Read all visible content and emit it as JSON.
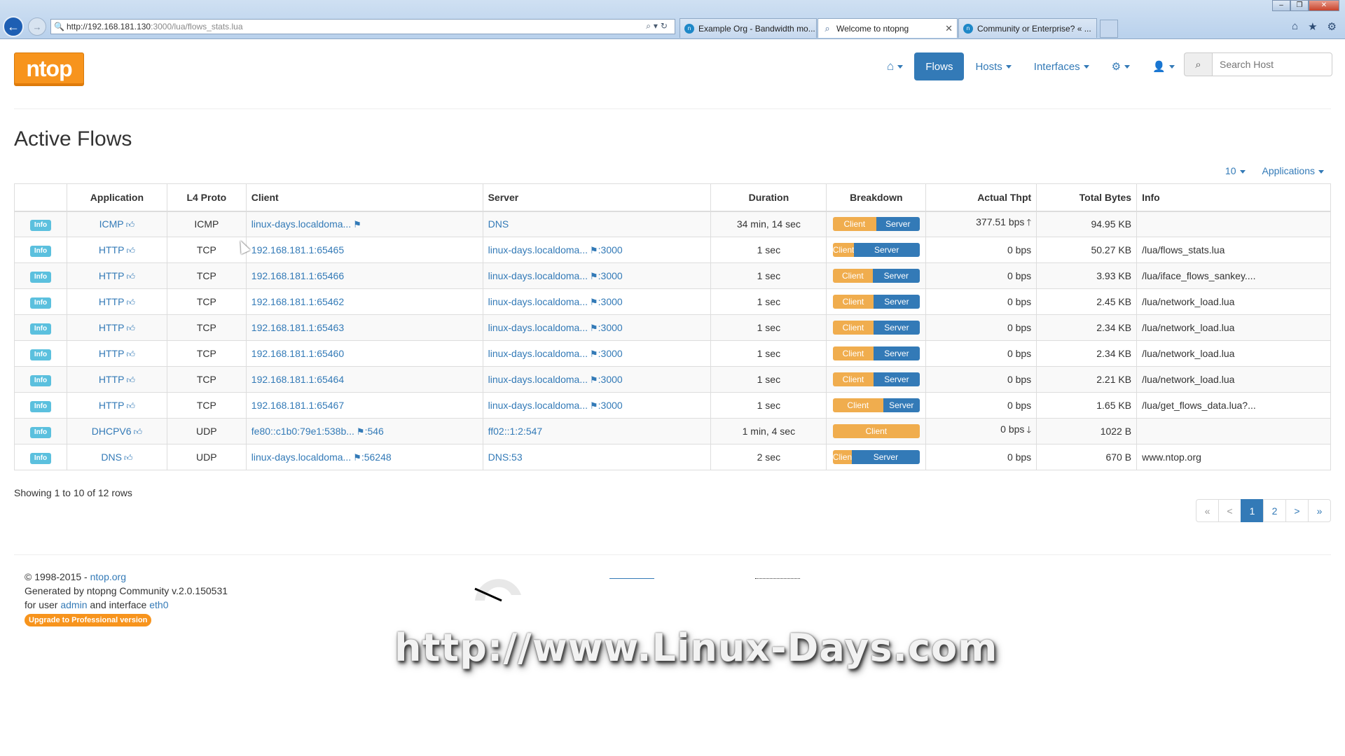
{
  "browser": {
    "url_host": "http://192.168.181.130",
    "url_rest": ":3000/lua/flows_stats.lua",
    "tabs": [
      {
        "title": "Example Org - Bandwidth mo...",
        "active": false
      },
      {
        "title": "Welcome to ntopng",
        "active": true
      },
      {
        "title": "Community or Enterprise? « ...",
        "active": false
      }
    ]
  },
  "navbar": {
    "logo": "ntop",
    "flows": "Flows",
    "hosts": "Hosts",
    "interfaces": "Interfaces",
    "search_placeholder": "Search Host"
  },
  "page": {
    "title": "Active Flows",
    "toolbar": {
      "rows_per_page": "10",
      "applications": "Applications"
    }
  },
  "table": {
    "headers": [
      "Application",
      "L4 Proto",
      "Client",
      "Server",
      "Duration",
      "Breakdown",
      "Actual Thpt",
      "Total Bytes",
      "Info"
    ],
    "rows": [
      {
        "info": "Info",
        "app": "ICMP",
        "proto": "ICMP",
        "client": "linux-days.localdoma...",
        "client_flag": true,
        "client_port": "",
        "server": "DNS",
        "server_flag": false,
        "server_port": "",
        "duration": "34 min, 14 sec",
        "client_pct": 50,
        "client_label": "Client",
        "server_label": "Server",
        "thpt": "377.51 bps",
        "trend": "up",
        "bytes": "94.95 KB",
        "info_text": ""
      },
      {
        "info": "Info",
        "app": "HTTP",
        "proto": "TCP",
        "client": "192.168.181.1:65465",
        "client_flag": false,
        "client_port": "",
        "server": "linux-days.localdoma...",
        "server_flag": true,
        "server_port": ":3000",
        "duration": "1 sec",
        "client_pct": 24,
        "client_label": "Client",
        "server_label": "Server",
        "thpt": "0 bps",
        "trend": "",
        "bytes": "50.27 KB",
        "info_text": "/lua/flows_stats.lua"
      },
      {
        "info": "Info",
        "app": "HTTP",
        "proto": "TCP",
        "client": "192.168.181.1:65466",
        "client_flag": false,
        "client_port": "",
        "server": "linux-days.localdoma...",
        "server_flag": true,
        "server_port": ":3000",
        "duration": "1 sec",
        "client_pct": 46,
        "client_label": "Client",
        "server_label": "Server",
        "thpt": "0 bps",
        "trend": "",
        "bytes": "3.93 KB",
        "info_text": "/lua/iface_flows_sankey...."
      },
      {
        "info": "Info",
        "app": "HTTP",
        "proto": "TCP",
        "client": "192.168.181.1:65462",
        "client_flag": false,
        "client_port": "",
        "server": "linux-days.localdoma...",
        "server_flag": true,
        "server_port": ":3000",
        "duration": "1 sec",
        "client_pct": 47,
        "client_label": "Client",
        "server_label": "Server",
        "thpt": "0 bps",
        "trend": "",
        "bytes": "2.45 KB",
        "info_text": "/lua/network_load.lua"
      },
      {
        "info": "Info",
        "app": "HTTP",
        "proto": "TCP",
        "client": "192.168.181.1:65463",
        "client_flag": false,
        "client_port": "",
        "server": "linux-days.localdoma...",
        "server_flag": true,
        "server_port": ":3000",
        "duration": "1 sec",
        "client_pct": 47,
        "client_label": "Client",
        "server_label": "Server",
        "thpt": "0 bps",
        "trend": "",
        "bytes": "2.34 KB",
        "info_text": "/lua/network_load.lua"
      },
      {
        "info": "Info",
        "app": "HTTP",
        "proto": "TCP",
        "client": "192.168.181.1:65460",
        "client_flag": false,
        "client_port": "",
        "server": "linux-days.localdoma...",
        "server_flag": true,
        "server_port": ":3000",
        "duration": "1 sec",
        "client_pct": 47,
        "client_label": "Client",
        "server_label": "Server",
        "thpt": "0 bps",
        "trend": "",
        "bytes": "2.34 KB",
        "info_text": "/lua/network_load.lua"
      },
      {
        "info": "Info",
        "app": "HTTP",
        "proto": "TCP",
        "client": "192.168.181.1:65464",
        "client_flag": false,
        "client_port": "",
        "server": "linux-days.localdoma...",
        "server_flag": true,
        "server_port": ":3000",
        "duration": "1 sec",
        "client_pct": 47,
        "client_label": "Client",
        "server_label": "Server",
        "thpt": "0 bps",
        "trend": "",
        "bytes": "2.21 KB",
        "info_text": "/lua/network_load.lua"
      },
      {
        "info": "Info",
        "app": "HTTP",
        "proto": "TCP",
        "client": "192.168.181.1:65467",
        "client_flag": false,
        "client_port": "",
        "server": "linux-days.localdoma...",
        "server_flag": true,
        "server_port": ":3000",
        "duration": "1 sec",
        "client_pct": 58,
        "client_label": "Client",
        "server_label": "Server",
        "thpt": "0 bps",
        "trend": "",
        "bytes": "1.65 KB",
        "info_text": "/lua/get_flows_data.lua?..."
      },
      {
        "info": "Info",
        "app": "DHCPV6",
        "proto": "UDP",
        "client": "fe80::c1b0:79e1:538b...",
        "client_flag": true,
        "client_port": ":546",
        "server": "ff02::1:2:547",
        "server_flag": false,
        "server_port": "",
        "duration": "1 min, 4 sec",
        "client_pct": 100,
        "client_label": "Client",
        "server_label": "",
        "thpt": "0 bps",
        "trend": "down",
        "bytes": "1022 B",
        "info_text": ""
      },
      {
        "info": "Info",
        "app": "DNS",
        "proto": "UDP",
        "client": "linux-days.localdoma...",
        "client_flag": true,
        "client_port": ":56248",
        "server": "DNS:53",
        "server_flag": false,
        "server_port": "",
        "duration": "2 sec",
        "client_pct": 22,
        "client_label": "Clien",
        "server_label": "Server",
        "thpt": "0 bps",
        "trend": "",
        "bytes": "670 B",
        "info_text": "www.ntop.org"
      }
    ]
  },
  "showing": "Showing 1 to 10 of 12 rows",
  "pagination": [
    "«",
    "<",
    "1",
    "2",
    ">",
    "»"
  ],
  "footer": {
    "copyright": "© 1998-2015 - ",
    "site": "ntop.org",
    "generated": "Generated by ntopng Community v.2.0.150531",
    "user_prefix": "for user ",
    "user": "admin",
    "iface_prefix": " and interface ",
    "iface": "eth0",
    "upgrade": "Upgrade to Professional version"
  },
  "watermark": "http://www.Linux-Days.com",
  "colors": {
    "primary": "#337ab7",
    "client_bar": "#f0ad4e",
    "info_label": "#5bc0de",
    "logo": "#f7941d"
  }
}
